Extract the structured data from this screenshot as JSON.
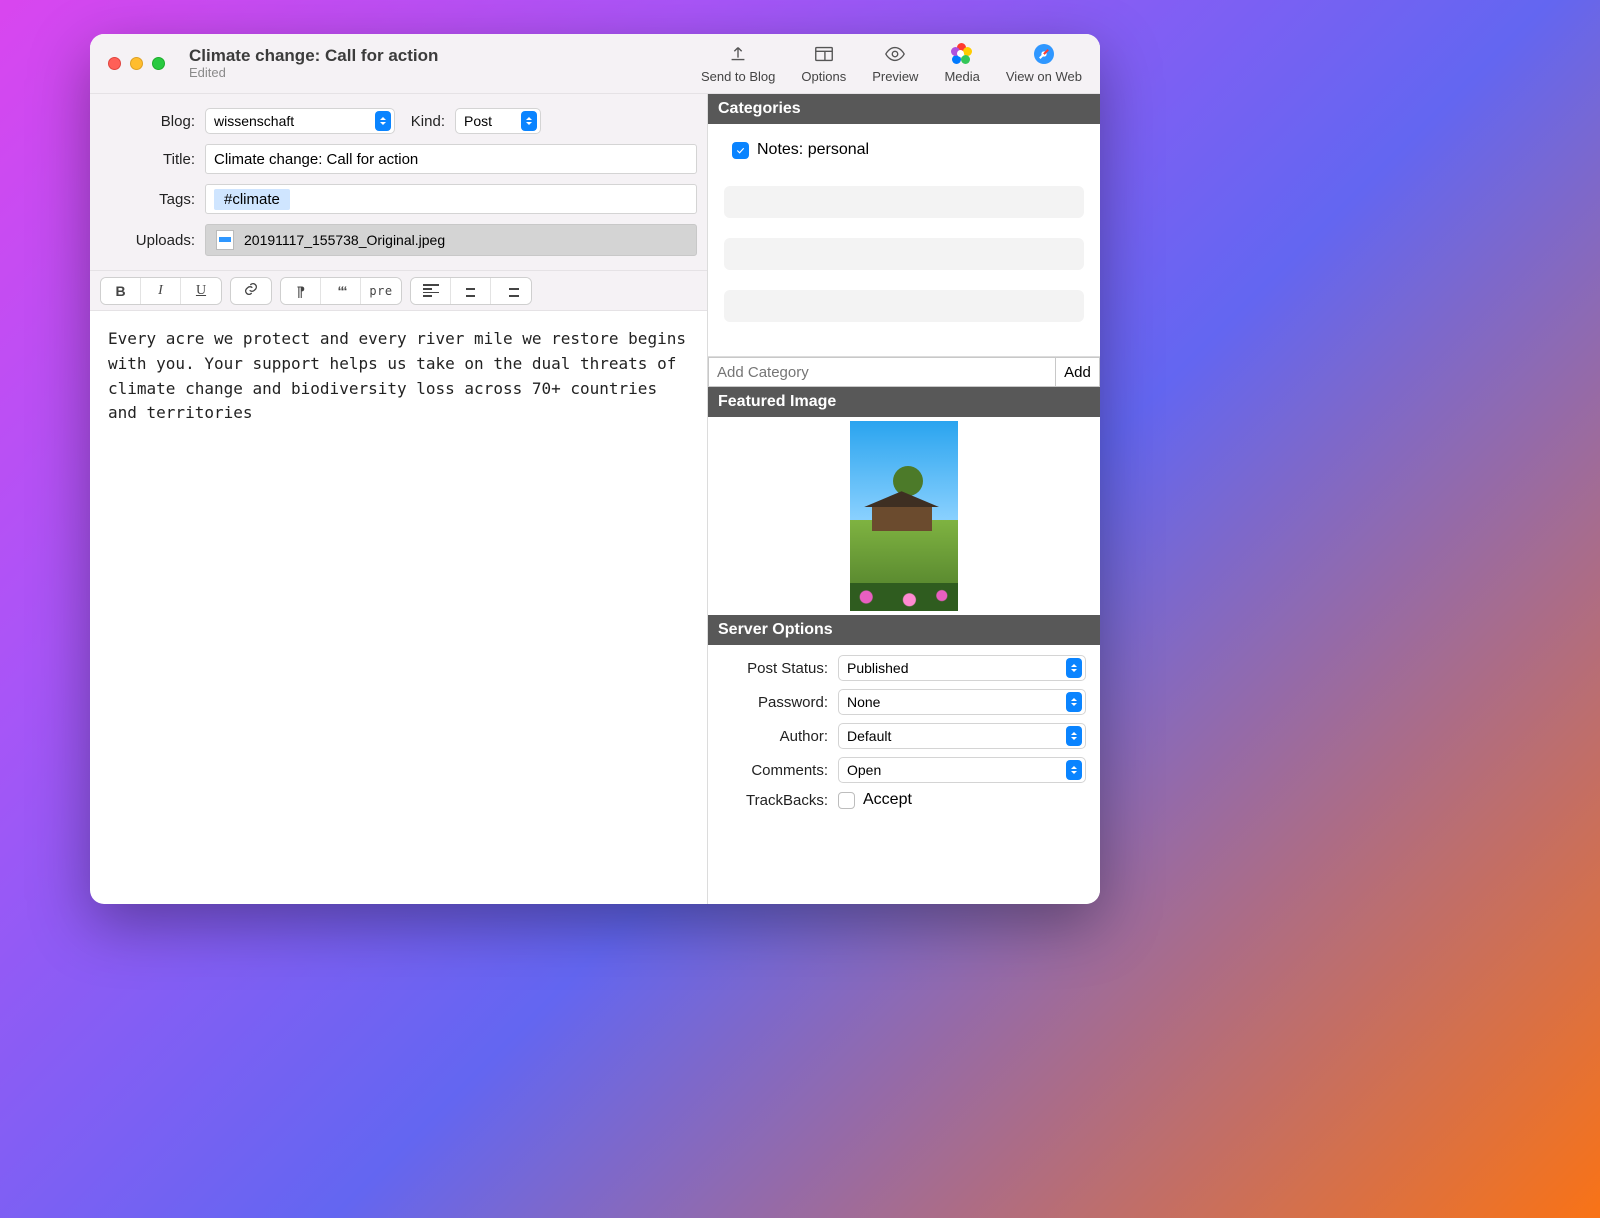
{
  "window": {
    "title": "Climate change: Call for action",
    "subtitle": "Edited"
  },
  "toolbar": {
    "send": "Send to Blog",
    "options": "Options",
    "preview": "Preview",
    "media": "Media",
    "view": "View on Web"
  },
  "form": {
    "blog_label": "Blog:",
    "blog_value": "wissenschaft",
    "kind_label": "Kind:",
    "kind_value": "Post",
    "title_label": "Title:",
    "title_value": "Climate change: Call for action",
    "tags_label": "Tags:",
    "tag_chip": "#climate",
    "uploads_label": "Uploads:",
    "upload_file": "20191117_155738_Original.jpeg"
  },
  "format_buttons": {
    "bold": "B",
    "italic": "I",
    "underline": "U",
    "pre": "pre"
  },
  "editor_body": "Every acre we protect and every river mile we restore begins with you. Your support helps us take on the dual threats of climate change and biodiversity loss across 70+ countries and territories",
  "categories": {
    "header": "Categories",
    "item1": "Notes: personal",
    "add_placeholder": "Add Category",
    "add_button": "Add"
  },
  "featured": {
    "header": "Featured Image"
  },
  "server": {
    "header": "Server Options",
    "status_label": "Post Status:",
    "status_value": "Published",
    "password_label": "Password:",
    "password_value": "None",
    "author_label": "Author:",
    "author_value": "Default",
    "comments_label": "Comments:",
    "comments_value": "Open",
    "trackbacks_label": "TrackBacks:",
    "trackbacks_value": "Accept"
  }
}
